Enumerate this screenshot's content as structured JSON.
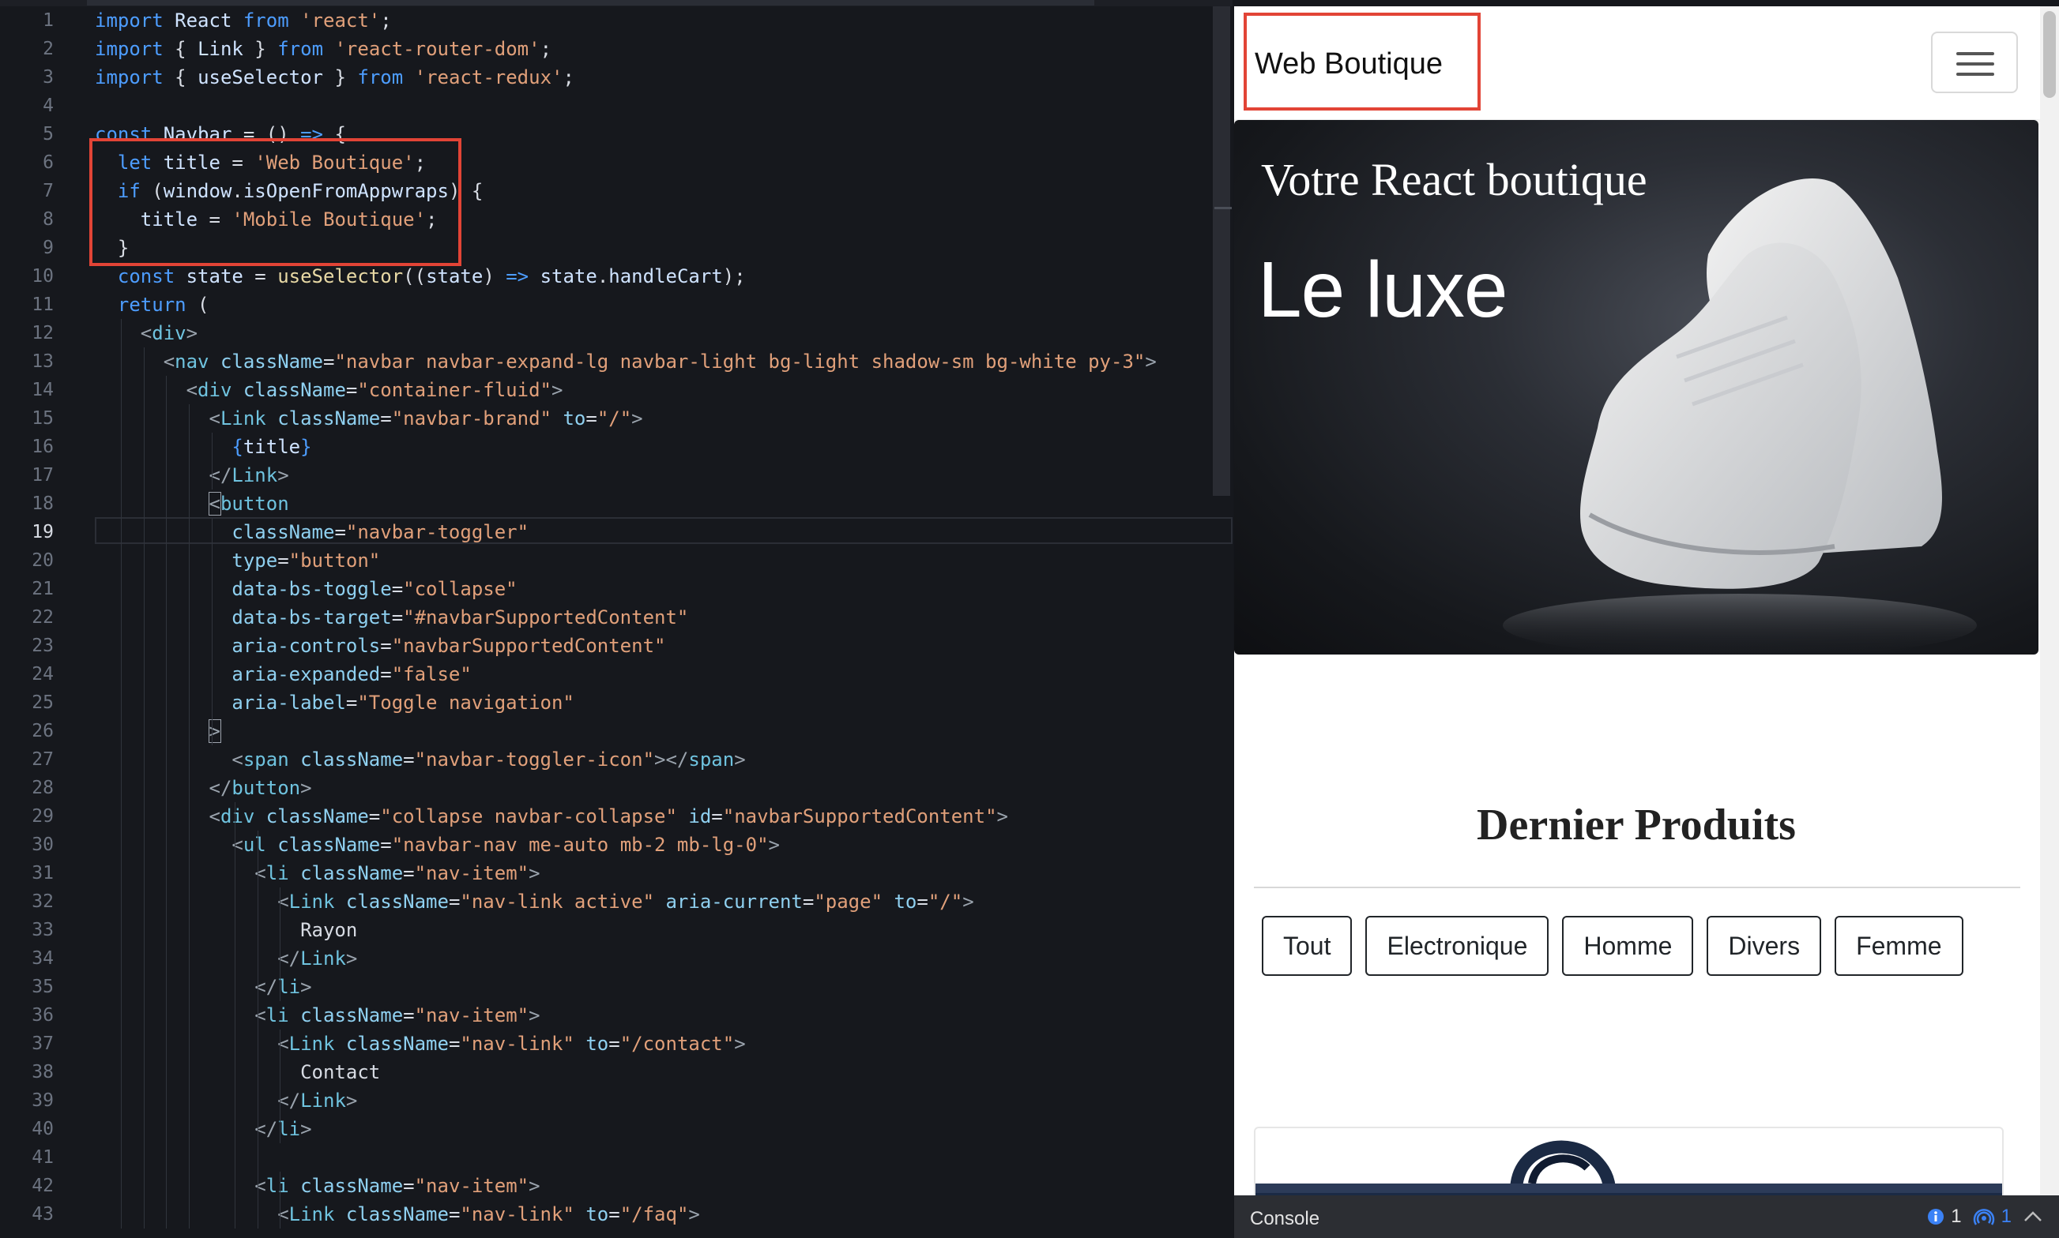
{
  "editor": {
    "active_line": 19,
    "line_numbers": [
      "1",
      "2",
      "3",
      "4",
      "5",
      "6",
      "7",
      "8",
      "9",
      "10",
      "11",
      "12",
      "13",
      "14",
      "15",
      "16",
      "17",
      "18",
      "19",
      "20",
      "21",
      "22",
      "23",
      "24",
      "25",
      "26",
      "27",
      "28",
      "29",
      "30",
      "31",
      "32",
      "33",
      "34",
      "35",
      "36",
      "37",
      "38",
      "39",
      "40",
      "41",
      "42",
      "43"
    ],
    "lines": [
      [
        {
          "t": "import ",
          "c": "kw"
        },
        {
          "t": "React ",
          "c": "id"
        },
        {
          "t": "from ",
          "c": "kw"
        },
        {
          "t": "'react'",
          "c": "str"
        },
        {
          "t": ";",
          "c": "plain"
        }
      ],
      [
        {
          "t": "import ",
          "c": "kw"
        },
        {
          "t": "{ ",
          "c": "plain"
        },
        {
          "t": "Link",
          "c": "id"
        },
        {
          "t": " } ",
          "c": "plain"
        },
        {
          "t": "from ",
          "c": "kw"
        },
        {
          "t": "'react-router-dom'",
          "c": "str"
        },
        {
          "t": ";",
          "c": "plain"
        }
      ],
      [
        {
          "t": "import ",
          "c": "kw"
        },
        {
          "t": "{ ",
          "c": "plain"
        },
        {
          "t": "useSelector",
          "c": "id"
        },
        {
          "t": " } ",
          "c": "plain"
        },
        {
          "t": "from ",
          "c": "kw"
        },
        {
          "t": "'react-redux'",
          "c": "str"
        },
        {
          "t": ";",
          "c": "plain"
        }
      ],
      [],
      [
        {
          "t": "const ",
          "c": "kw"
        },
        {
          "t": "Navbar ",
          "c": "id"
        },
        {
          "t": "= () ",
          "c": "plain"
        },
        {
          "t": "=> ",
          "c": "kw"
        },
        {
          "t": "{",
          "c": "plain"
        }
      ],
      [
        {
          "t": "  let ",
          "c": "kw"
        },
        {
          "t": "title ",
          "c": "id"
        },
        {
          "t": "= ",
          "c": "plain"
        },
        {
          "t": "'Web Boutique'",
          "c": "str"
        },
        {
          "t": ";",
          "c": "plain"
        }
      ],
      [
        {
          "t": "  if ",
          "c": "kw"
        },
        {
          "t": "(",
          "c": "plain"
        },
        {
          "t": "window",
          "c": "id"
        },
        {
          "t": ".",
          "c": "plain"
        },
        {
          "t": "isOpenFromAppwraps",
          "c": "id"
        },
        {
          "t": ") {",
          "c": "plain"
        }
      ],
      [
        {
          "t": "    title ",
          "c": "id"
        },
        {
          "t": "= ",
          "c": "plain"
        },
        {
          "t": "'Mobile Boutique'",
          "c": "str"
        },
        {
          "t": ";",
          "c": "plain"
        }
      ],
      [
        {
          "t": "  }",
          "c": "plain"
        }
      ],
      [
        {
          "t": "  const ",
          "c": "kw"
        },
        {
          "t": "state ",
          "c": "id"
        },
        {
          "t": "= ",
          "c": "plain"
        },
        {
          "t": "useSelector",
          "c": "fn"
        },
        {
          "t": "((",
          "c": "plain"
        },
        {
          "t": "state",
          "c": "id"
        },
        {
          "t": ") ",
          "c": "plain"
        },
        {
          "t": "=> ",
          "c": "kw"
        },
        {
          "t": "state",
          "c": "id"
        },
        {
          "t": ".",
          "c": "plain"
        },
        {
          "t": "handleCart",
          "c": "id"
        },
        {
          "t": ");",
          "c": "plain"
        }
      ],
      [
        {
          "t": "  return ",
          "c": "kw"
        },
        {
          "t": "(",
          "c": "plain"
        }
      ],
      [
        {
          "t": "    <",
          "c": "tag"
        },
        {
          "t": "div",
          "c": "name"
        },
        {
          "t": ">",
          "c": "tag"
        }
      ],
      [
        {
          "t": "      <",
          "c": "tag"
        },
        {
          "t": "nav ",
          "c": "name"
        },
        {
          "t": "className",
          "c": "attr"
        },
        {
          "t": "=",
          "c": "plain"
        },
        {
          "t": "\"navbar navbar-expand-lg navbar-light bg-light shadow-sm bg-white py-3\"",
          "c": "str"
        },
        {
          "t": ">",
          "c": "tag"
        }
      ],
      [
        {
          "t": "        <",
          "c": "tag"
        },
        {
          "t": "div ",
          "c": "name"
        },
        {
          "t": "className",
          "c": "attr"
        },
        {
          "t": "=",
          "c": "plain"
        },
        {
          "t": "\"container-fluid\"",
          "c": "str"
        },
        {
          "t": ">",
          "c": "tag"
        }
      ],
      [
        {
          "t": "          <",
          "c": "tag"
        },
        {
          "t": "Link ",
          "c": "name"
        },
        {
          "t": "className",
          "c": "attr"
        },
        {
          "t": "=",
          "c": "plain"
        },
        {
          "t": "\"navbar-brand\" ",
          "c": "str"
        },
        {
          "t": "to",
          "c": "attr"
        },
        {
          "t": "=",
          "c": "plain"
        },
        {
          "t": "\"/\"",
          "c": "str"
        },
        {
          "t": ">",
          "c": "tag"
        }
      ],
      [
        {
          "t": "            {",
          "c": "kw"
        },
        {
          "t": "title",
          "c": "id"
        },
        {
          "t": "}",
          "c": "kw"
        }
      ],
      [
        {
          "t": "          </",
          "c": "tag"
        },
        {
          "t": "Link",
          "c": "name"
        },
        {
          "t": ">",
          "c": "tag"
        }
      ],
      [
        {
          "t": "          ",
          "c": "plain"
        },
        {
          "t": "<",
          "c": "tag",
          "box": true
        },
        {
          "t": "button",
          "c": "name"
        }
      ],
      [
        {
          "t": "            className",
          "c": "attr"
        },
        {
          "t": "=",
          "c": "plain"
        },
        {
          "t": "\"navbar-toggler\"",
          "c": "str"
        }
      ],
      [
        {
          "t": "            type",
          "c": "attr"
        },
        {
          "t": "=",
          "c": "plain"
        },
        {
          "t": "\"button\"",
          "c": "str"
        }
      ],
      [
        {
          "t": "            data-bs-toggle",
          "c": "attr"
        },
        {
          "t": "=",
          "c": "plain"
        },
        {
          "t": "\"collapse\"",
          "c": "str"
        }
      ],
      [
        {
          "t": "            data-bs-target",
          "c": "attr"
        },
        {
          "t": "=",
          "c": "plain"
        },
        {
          "t": "\"#navbarSupportedContent\"",
          "c": "str"
        }
      ],
      [
        {
          "t": "            aria-controls",
          "c": "attr"
        },
        {
          "t": "=",
          "c": "plain"
        },
        {
          "t": "\"navbarSupportedContent\"",
          "c": "str"
        }
      ],
      [
        {
          "t": "            aria-expanded",
          "c": "attr"
        },
        {
          "t": "=",
          "c": "plain"
        },
        {
          "t": "\"false\"",
          "c": "str"
        }
      ],
      [
        {
          "t": "            aria-label",
          "c": "attr"
        },
        {
          "t": "=",
          "c": "plain"
        },
        {
          "t": "\"Toggle navigation\"",
          "c": "str"
        }
      ],
      [
        {
          "t": "          ",
          "c": "plain"
        },
        {
          "t": ">",
          "c": "tag",
          "box": true
        }
      ],
      [
        {
          "t": "            <",
          "c": "tag"
        },
        {
          "t": "span ",
          "c": "name"
        },
        {
          "t": "className",
          "c": "attr"
        },
        {
          "t": "=",
          "c": "plain"
        },
        {
          "t": "\"navbar-toggler-icon\"",
          "c": "str"
        },
        {
          "t": "></",
          "c": "tag"
        },
        {
          "t": "span",
          "c": "name"
        },
        {
          "t": ">",
          "c": "tag"
        }
      ],
      [
        {
          "t": "          </",
          "c": "tag"
        },
        {
          "t": "button",
          "c": "name"
        },
        {
          "t": ">",
          "c": "tag"
        }
      ],
      [
        {
          "t": "          <",
          "c": "tag"
        },
        {
          "t": "div ",
          "c": "name"
        },
        {
          "t": "className",
          "c": "attr"
        },
        {
          "t": "=",
          "c": "plain"
        },
        {
          "t": "\"collapse navbar-collapse\" ",
          "c": "str"
        },
        {
          "t": "id",
          "c": "attr"
        },
        {
          "t": "=",
          "c": "plain"
        },
        {
          "t": "\"navbarSupportedContent\"",
          "c": "str"
        },
        {
          "t": ">",
          "c": "tag"
        }
      ],
      [
        {
          "t": "            <",
          "c": "tag"
        },
        {
          "t": "ul ",
          "c": "name"
        },
        {
          "t": "className",
          "c": "attr"
        },
        {
          "t": "=",
          "c": "plain"
        },
        {
          "t": "\"navbar-nav me-auto mb-2 mb-lg-0\"",
          "c": "str"
        },
        {
          "t": ">",
          "c": "tag"
        }
      ],
      [
        {
          "t": "              <",
          "c": "tag"
        },
        {
          "t": "li ",
          "c": "name"
        },
        {
          "t": "className",
          "c": "attr"
        },
        {
          "t": "=",
          "c": "plain"
        },
        {
          "t": "\"nav-item\"",
          "c": "str"
        },
        {
          "t": ">",
          "c": "tag"
        }
      ],
      [
        {
          "t": "                <",
          "c": "tag"
        },
        {
          "t": "Link ",
          "c": "name"
        },
        {
          "t": "className",
          "c": "attr"
        },
        {
          "t": "=",
          "c": "plain"
        },
        {
          "t": "\"nav-link active\" ",
          "c": "str"
        },
        {
          "t": "aria-current",
          "c": "attr"
        },
        {
          "t": "=",
          "c": "plain"
        },
        {
          "t": "\"page\" ",
          "c": "str"
        },
        {
          "t": "to",
          "c": "attr"
        },
        {
          "t": "=",
          "c": "plain"
        },
        {
          "t": "\"/\"",
          "c": "str"
        },
        {
          "t": ">",
          "c": "tag"
        }
      ],
      [
        {
          "t": "                  Rayon",
          "c": "plain"
        }
      ],
      [
        {
          "t": "                </",
          "c": "tag"
        },
        {
          "t": "Link",
          "c": "name"
        },
        {
          "t": ">",
          "c": "tag"
        }
      ],
      [
        {
          "t": "              </",
          "c": "tag"
        },
        {
          "t": "li",
          "c": "name"
        },
        {
          "t": ">",
          "c": "tag"
        }
      ],
      [
        {
          "t": "              <",
          "c": "tag"
        },
        {
          "t": "li ",
          "c": "name"
        },
        {
          "t": "className",
          "c": "attr"
        },
        {
          "t": "=",
          "c": "plain"
        },
        {
          "t": "\"nav-item\"",
          "c": "str"
        },
        {
          "t": ">",
          "c": "tag"
        }
      ],
      [
        {
          "t": "                <",
          "c": "tag"
        },
        {
          "t": "Link ",
          "c": "name"
        },
        {
          "t": "className",
          "c": "attr"
        },
        {
          "t": "=",
          "c": "plain"
        },
        {
          "t": "\"nav-link\" ",
          "c": "str"
        },
        {
          "t": "to",
          "c": "attr"
        },
        {
          "t": "=",
          "c": "plain"
        },
        {
          "t": "\"/contact\"",
          "c": "str"
        },
        {
          "t": ">",
          "c": "tag"
        }
      ],
      [
        {
          "t": "                  Contact",
          "c": "plain"
        }
      ],
      [
        {
          "t": "                </",
          "c": "tag"
        },
        {
          "t": "Link",
          "c": "name"
        },
        {
          "t": ">",
          "c": "tag"
        }
      ],
      [
        {
          "t": "              </",
          "c": "tag"
        },
        {
          "t": "li",
          "c": "name"
        },
        {
          "t": ">",
          "c": "tag"
        }
      ],
      [],
      [
        {
          "t": "              <",
          "c": "tag"
        },
        {
          "t": "li ",
          "c": "name"
        },
        {
          "t": "className",
          "c": "attr"
        },
        {
          "t": "=",
          "c": "plain"
        },
        {
          "t": "\"nav-item\"",
          "c": "str"
        },
        {
          "t": ">",
          "c": "tag"
        }
      ],
      [
        {
          "t": "                <",
          "c": "tag"
        },
        {
          "t": "Link ",
          "c": "name"
        },
        {
          "t": "className",
          "c": "attr"
        },
        {
          "t": "=",
          "c": "plain"
        },
        {
          "t": "\"nav-link\" ",
          "c": "str"
        },
        {
          "t": "to",
          "c": "attr"
        },
        {
          "t": "=",
          "c": "plain"
        },
        {
          "t": "\"/faq\"",
          "c": "str"
        },
        {
          "t": ">",
          "c": "tag"
        }
      ]
    ]
  },
  "preview": {
    "brand": "Web Boutique",
    "toggler_icon": "hamburger-icon",
    "hero": {
      "title": "Votre React boutique",
      "subtitle": "Le luxe"
    },
    "section_title": "Dernier Produits",
    "filters": [
      "Tout",
      "Electronique",
      "Homme",
      "Divers",
      "Femme"
    ]
  },
  "console": {
    "label": "Console",
    "info_count": "1",
    "network_count": "1",
    "icons": [
      "info-icon",
      "broadcast-icon",
      "chevron-up-icon"
    ]
  },
  "colors": {
    "highlight": "#e24436",
    "editor_bg": "#16181d",
    "keyword": "#4d9dff",
    "string": "#e1a07a"
  }
}
